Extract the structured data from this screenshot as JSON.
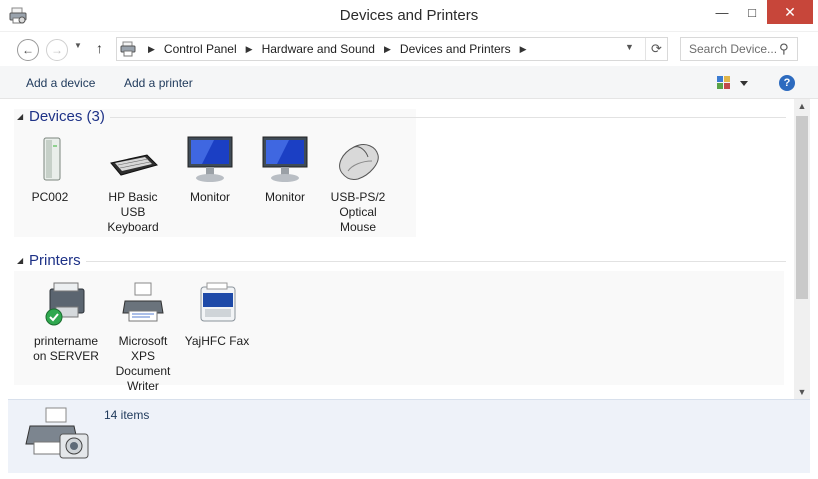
{
  "window": {
    "title": "Devices and Printers"
  },
  "titlebar_buttons": {
    "minimize": "—",
    "maximize": "□",
    "close": "✕"
  },
  "nav": {
    "back_glyph": "←",
    "forward_glyph": "→",
    "up_glyph": "↑",
    "breadcrumbs": [
      "Control Panel",
      "Hardware and Sound",
      "Devices and Printers"
    ],
    "search_placeholder": "Search Device..."
  },
  "toolbar": {
    "add_device_label": "Add a device",
    "add_printer_label": "Add a printer",
    "help_glyph": "?"
  },
  "devices": {
    "header": "Devices (3)",
    "items": [
      {
        "label": "PC002",
        "icon": "computer-tower-icon"
      },
      {
        "label": "HP Basic USB Keyboard",
        "icon": "keyboard-icon"
      },
      {
        "label": "Monitor",
        "icon": "monitor-icon"
      },
      {
        "label": "Monitor",
        "icon": "monitor-icon"
      },
      {
        "label": "USB-PS/2 Optical Mouse",
        "icon": "mouse-icon"
      }
    ]
  },
  "printers": {
    "header": "Printers",
    "items": [
      {
        "label": "printername on SERVER",
        "icon": "default-printer-icon"
      },
      {
        "label": "Microsoft XPS Document Writer",
        "icon": "printer-icon"
      },
      {
        "label": "YajHFC Fax",
        "icon": "fax-icon"
      }
    ]
  },
  "details": {
    "count_text": "14 items"
  },
  "colors": {
    "accent": "#1e3287",
    "close": "#c7463a",
    "details_bg": "#eef2f9"
  }
}
